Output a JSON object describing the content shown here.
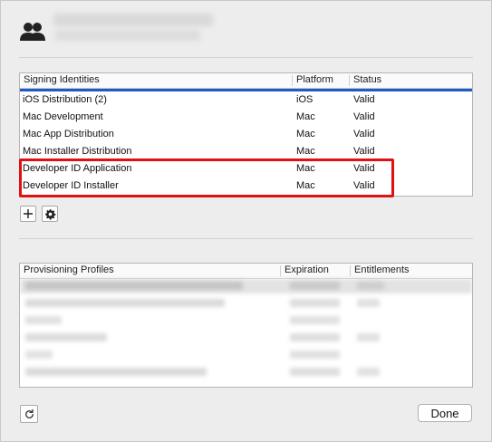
{
  "identities_table": {
    "headers": {
      "name": "Signing Identities",
      "platform": "Platform",
      "status": "Status"
    },
    "rows": [
      {
        "name": "iOS Distribution (2)",
        "platform": "iOS",
        "status": "Valid"
      },
      {
        "name": "Mac Development",
        "platform": "Mac",
        "status": "Valid"
      },
      {
        "name": "Mac App Distribution",
        "platform": "Mac",
        "status": "Valid"
      },
      {
        "name": "Mac Installer Distribution",
        "platform": "Mac",
        "status": "Valid"
      },
      {
        "name": "Developer ID Application",
        "platform": "Mac",
        "status": "Valid"
      },
      {
        "name": "Developer ID Installer",
        "platform": "Mac",
        "status": "Valid"
      }
    ],
    "add_icon": "plus-icon",
    "gear_icon": "gear-icon"
  },
  "profiles_table": {
    "headers": {
      "name": "Provisioning Profiles",
      "expiration": "Expiration",
      "entitlements": "Entitlements"
    }
  },
  "footer": {
    "refresh_icon": "refresh-icon",
    "done_label": "Done"
  },
  "colors": {
    "selection": "#1f5bc8",
    "highlight": "#e01111"
  }
}
